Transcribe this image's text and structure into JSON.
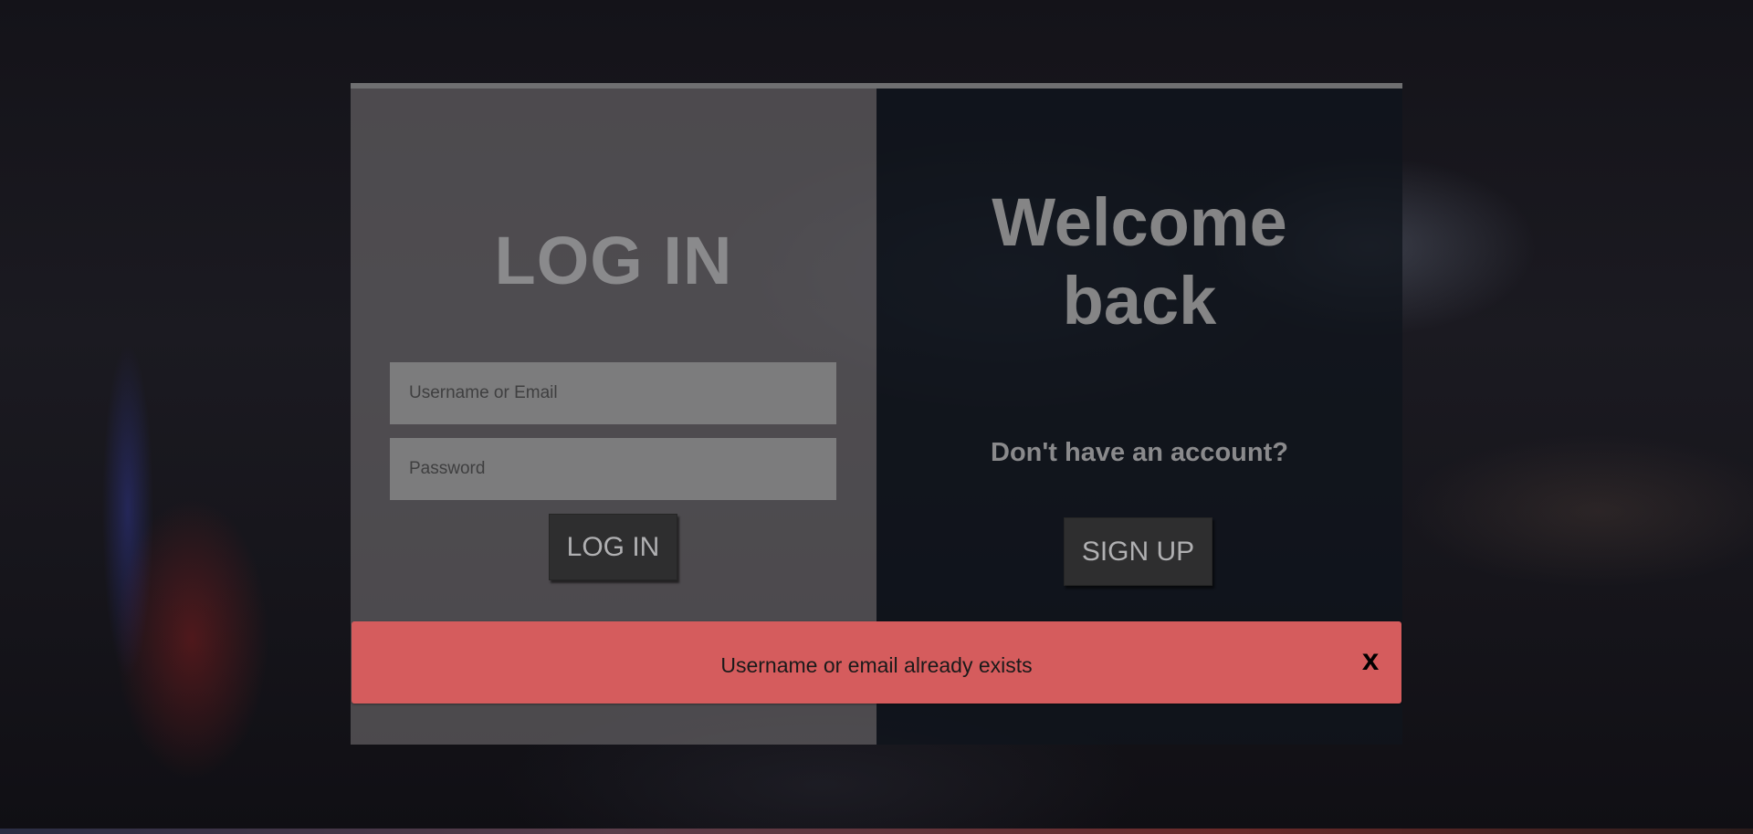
{
  "login_panel": {
    "title": "LOG IN",
    "username_placeholder": "Username or Email",
    "password_placeholder": "Password",
    "submit_label": "LOG IN"
  },
  "signup_panel": {
    "title_line1": "Welcome",
    "title_line2": "back",
    "prompt": "Don't have an account?",
    "signup_label": "SIGN UP"
  },
  "alert": {
    "message": "Username or email already exists",
    "close_label": "x",
    "color": "#d55c5d"
  }
}
